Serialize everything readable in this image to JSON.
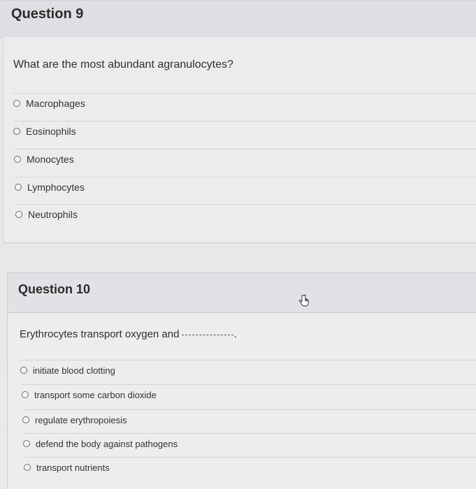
{
  "question9": {
    "title": "Question 9",
    "prompt": "What are the most abundant agranulocytes?",
    "options": [
      "Macrophages",
      "Eosinophils",
      "Monocytes",
      "Lymphocytes",
      "Neutrophils"
    ]
  },
  "question10": {
    "title": "Question 10",
    "prompt": "Erythrocytes transport oxygen and",
    "prompt_end": ".",
    "options": [
      "initiate blood clotting",
      "transport some carbon dioxide",
      "regulate erythropoiesis",
      "defend the body against pathogens",
      "transport nutrients"
    ]
  },
  "icons": {
    "radio": "radio-button-icon",
    "cursor": "hand-pointer-icon"
  },
  "colors": {
    "background": "#e9e9ea",
    "header": "#dedfe2",
    "text": "#2f2f2f"
  }
}
